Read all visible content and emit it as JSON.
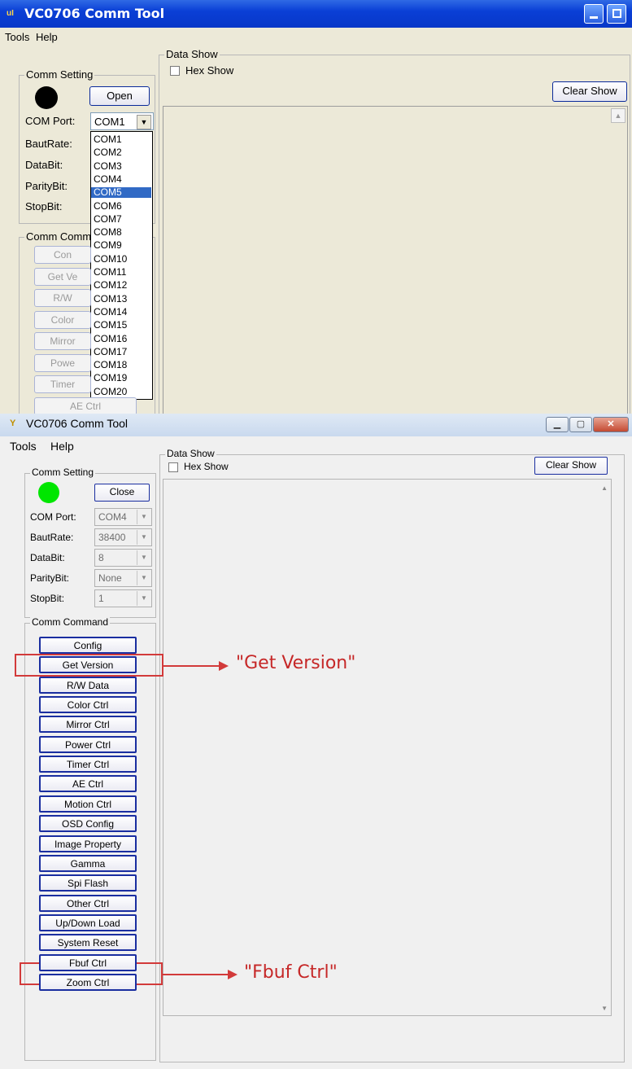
{
  "window1": {
    "title": "VC0706 Comm Tool",
    "app_icon": "uI",
    "menu": [
      "Tools",
      "Help"
    ],
    "comm_setting": {
      "label": "Comm Setting",
      "status_color": "#000000",
      "open_button": "Open",
      "fields": [
        {
          "label": "COM Port:",
          "value": "COM1"
        },
        {
          "label": "BautRate:"
        },
        {
          "label": "DataBit:"
        },
        {
          "label": "ParityBit:"
        },
        {
          "label": "StopBit:"
        }
      ],
      "dropdown_options": [
        "COM1",
        "COM2",
        "COM3",
        "COM4",
        "COM5",
        "COM6",
        "COM7",
        "COM8",
        "COM9",
        "COM10",
        "COM11",
        "COM12",
        "COM13",
        "COM14",
        "COM15",
        "COM16",
        "COM17",
        "COM18",
        "COM19",
        "COM20"
      ],
      "dropdown_selected": "COM5"
    },
    "comm_command": {
      "label": "Comm Comm",
      "buttons_visible": [
        "Con",
        "Get Ve",
        "R/W",
        "Color",
        "Mirror",
        "Powe",
        "Timer",
        "AE Ctrl"
      ]
    },
    "data_show": {
      "label": "Data Show",
      "hex_show_label": "Hex Show",
      "hex_show_checked": false,
      "clear_button": "Clear Show"
    }
  },
  "window2": {
    "title": "VC0706 Comm Tool",
    "app_icon": "Y",
    "menu": [
      "Tools",
      "Help"
    ],
    "comm_setting": {
      "label": "Comm Setting",
      "status_color": "#00e600",
      "close_button": "Close",
      "fields": [
        {
          "label": "COM Port:",
          "value": "COM4"
        },
        {
          "label": "BautRate:",
          "value": "38400"
        },
        {
          "label": "DataBit:",
          "value": "8"
        },
        {
          "label": "ParityBit:",
          "value": "None"
        },
        {
          "label": "StopBit:",
          "value": "1"
        }
      ]
    },
    "comm_command": {
      "label": "Comm Command",
      "buttons": [
        "Config",
        "Get Version",
        "R/W Data",
        "Color Ctrl",
        "Mirror Ctrl",
        "Power Ctrl",
        "Timer Ctrl",
        "AE Ctrl",
        "Motion Ctrl",
        "OSD Config",
        "Image Property",
        "Gamma",
        "Spi Flash",
        "Other Ctrl",
        "Up/Down Load",
        "System Reset",
        "Fbuf Ctrl",
        "Zoom Ctrl"
      ]
    },
    "data_show": {
      "label": "Data Show",
      "hex_show_label": "Hex Show",
      "hex_show_checked": false,
      "clear_button": "Clear Show"
    },
    "annotations": [
      "\"Get Version\"",
      "\"Fbuf Ctrl\""
    ],
    "annotation_color": "#d23a3a"
  }
}
